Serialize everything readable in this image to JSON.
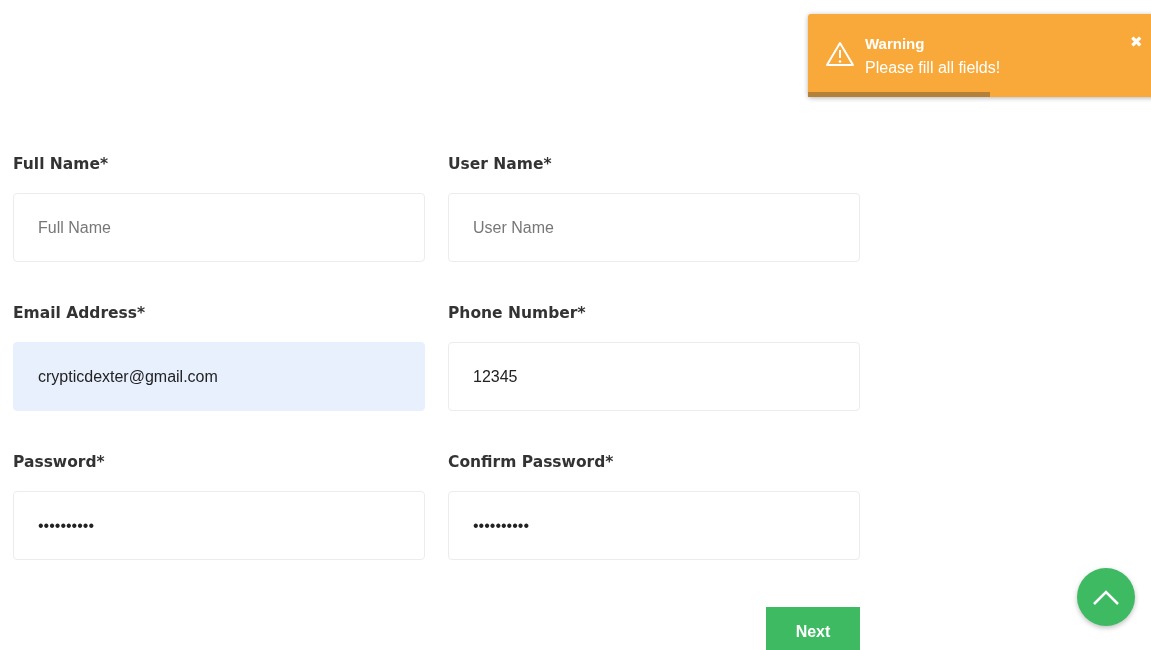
{
  "toast": {
    "title": "Warning",
    "message": "Please fill all fields!",
    "close": "✖",
    "level": 0.53
  },
  "fields": [
    {
      "label": "Full Name*",
      "placeholder": "Full Name",
      "highlighted": false
    },
    {
      "label": "User Name*",
      "placeholder": "User Name",
      "highlighted": false
    },
    {
      "label": "Email Address*",
      "value": "crypticdexter@gmail.com",
      "highlighted": true
    },
    {
      "label": "Phone Number*",
      "value": "12345",
      "highlighted": false
    },
    {
      "label": "Password*",
      "value": "••••••••••",
      "highlighted": false
    },
    {
      "label": "Confirm Password*",
      "value": "••••••••••",
      "highlighted": false
    }
  ],
  "next_button": "Next"
}
